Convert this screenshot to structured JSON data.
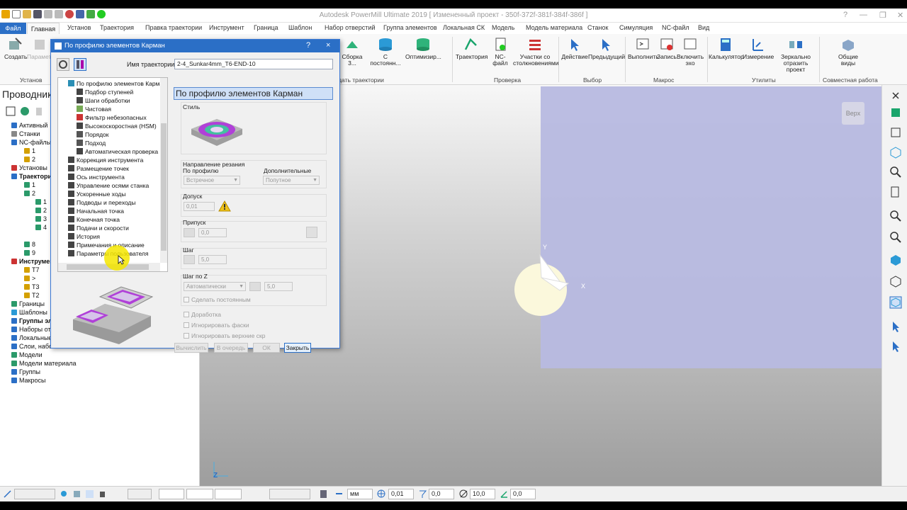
{
  "window": {
    "title": "Autodesk PowerMill Ultimate 2019   [ Измененный проект - 350f-372f-381f-384f-386f ]"
  },
  "ribbon_tabs": [
    "Файл",
    "Главная",
    "Установ",
    "Траектория",
    "Правка траектории",
    "Инструмент",
    "Граница",
    "Шаблон",
    "Набор отверстий",
    "Группа элементов",
    "Локальная СК",
    "Модель",
    "Модель материала",
    "Станок",
    "Симуляция",
    "NC-файл",
    "Вид"
  ],
  "ribbon": {
    "btn_create": "Создать",
    "btn_params": "Парамет...",
    "grp_setups": "Установ",
    "btn_set1": "Сборка 3...",
    "btn_set2": "С постоянн...",
    "btn_set3": "Оптимизир...",
    "grp_traj_create": "...дать траектории",
    "btn_traj": "Траектория",
    "btn_nc": "NC-файл",
    "btn_collide": "Участки со столкновениями",
    "grp_check": "Проверка",
    "btn_action": "Действие",
    "btn_prev": "Предыдущий",
    "grp_select": "Выбор",
    "btn_run": "Выполнить",
    "btn_record": "Запись",
    "btn_echo": "Включить эхо",
    "grp_macro": "Макрос",
    "btn_calc": "Калькулятор",
    "btn_measure": "Измерение",
    "btn_mirror": "Зеркально отразить проект",
    "grp_utils": "Утилиты",
    "btn_shared": "Общие виды",
    "grp_collab": "Совместная работа"
  },
  "explorer": {
    "title": "Проводник",
    "items": [
      {
        "label": "Активный",
        "bold": false
      },
      {
        "label": "Станки",
        "bold": false
      },
      {
        "label": "NC-файлы",
        "bold": false
      },
      {
        "label": "1",
        "bold": false
      },
      {
        "label": "2",
        "bold": false
      },
      {
        "label": "Установы",
        "bold": false
      },
      {
        "label": "Траектори",
        "bold": true
      },
      {
        "label": "1",
        "bold": false
      },
      {
        "label": "2",
        "bold": false
      },
      {
        "label": "1",
        "bold": false
      },
      {
        "label": "2",
        "bold": false
      },
      {
        "label": "3",
        "bold": false
      },
      {
        "label": "4",
        "bold": false
      },
      {
        "label": "8",
        "bold": false
      },
      {
        "label": "9",
        "bold": false
      },
      {
        "label": "Инструмент",
        "bold": true
      },
      {
        "label": "T7",
        "bold": false
      },
      {
        "label": ">",
        "bold": false
      },
      {
        "label": "T3",
        "bold": false
      },
      {
        "label": "T2",
        "bold": false
      },
      {
        "label": "Границы",
        "bold": false
      },
      {
        "label": "Шаблоны",
        "bold": false
      },
      {
        "label": "Группы эле",
        "bold": true
      },
      {
        "label": "Наборы отв",
        "bold": false
      },
      {
        "label": "Локальные",
        "bold": false
      },
      {
        "label": "Слои, набо",
        "bold": false
      },
      {
        "label": "Модели",
        "bold": false
      },
      {
        "label": "Модели материала",
        "bold": false
      },
      {
        "label": "Группы",
        "bold": false
      },
      {
        "label": "Макросы",
        "bold": false
      }
    ]
  },
  "viewport": {
    "view_label": "Верх",
    "axis_x": "X",
    "axis_y": "Y",
    "axis_z": "Z"
  },
  "dialog": {
    "title": "По профилю элементов Карман",
    "help": "?",
    "close": "×",
    "traj_name_label": "Имя траектории",
    "traj_name_value": "2-4_Sunkar4mm_T6-END-10",
    "tree": [
      {
        "label": "По профилю элементов Карман",
        "level": 0,
        "color": "#2b8fb5"
      },
      {
        "label": "Подбор ступеней",
        "level": 1,
        "color": "#444"
      },
      {
        "label": "Шаги обработки",
        "level": 1,
        "color": "#444"
      },
      {
        "label": "Чистовая",
        "level": 1,
        "color": "#7a5"
      },
      {
        "label": "Фильтр небезопасных",
        "level": 1,
        "color": "#c33"
      },
      {
        "label": "Высокоскоростная (HSM)",
        "level": 1,
        "color": "#444"
      },
      {
        "label": "Порядок",
        "level": 1,
        "color": "#555"
      },
      {
        "label": "Подход",
        "level": 1,
        "color": "#555"
      },
      {
        "label": "Автоматическая проверка",
        "level": 1,
        "color": "#444"
      },
      {
        "label": "Коррекция инструмента",
        "level": 0,
        "color": "#444"
      },
      {
        "label": "Размещение точек",
        "level": 0,
        "color": "#444"
      },
      {
        "label": "Ось инструмента",
        "level": 0,
        "color": "#444"
      },
      {
        "label": "Управление осями станка",
        "level": 0,
        "color": "#444"
      },
      {
        "label": "Ускоренные ходы",
        "level": 0,
        "color": "#444"
      },
      {
        "label": "Подводы и переходы",
        "level": 0,
        "color": "#444"
      },
      {
        "label": "Начальная точка",
        "level": 0,
        "color": "#444"
      },
      {
        "label": "Конечная точка",
        "level": 0,
        "color": "#444"
      },
      {
        "label": "Подачи и скорости",
        "level": 0,
        "color": "#444"
      },
      {
        "label": "История",
        "level": 0,
        "color": "#444"
      },
      {
        "label": "Примечания и описание",
        "level": 0,
        "color": "#444"
      },
      {
        "label": "Параметры пользователя",
        "level": 0,
        "color": "#444"
      }
    ],
    "panel": {
      "header": "По профилю элементов Карман",
      "style_label": "Стиль",
      "cut_dir_label": "Направление резания",
      "profile_label": "По профилю",
      "profile_value": "Встречное",
      "extra_label": "Дополнительные",
      "extra_value": "Попутное",
      "tolerance_label": "Допуск",
      "tolerance_value": "0,01",
      "allowance_label": "Припуск",
      "allowance_value": "0,0",
      "step_label": "Шаг",
      "step_value": "5,0",
      "zstep_label": "Шаг по Z",
      "zstep_mode": "Автоматически",
      "zstep_value": "5,0",
      "make_const_label": "Сделать постоянным",
      "rework_label": "Доработка",
      "ignore_chamfer_label": "Игнорировать фаски",
      "ignore_top_label": "Игнорировать верхние скр"
    },
    "buttons": {
      "calc": "Вычислить",
      "queue": "В очередь",
      "ok": "ОК",
      "close": "Закрыть"
    }
  },
  "statusbar": {
    "units": "мм",
    "tolerance": "0,01",
    "allowance": "0,0",
    "diameter": "10,0",
    "angle": "0,0"
  }
}
